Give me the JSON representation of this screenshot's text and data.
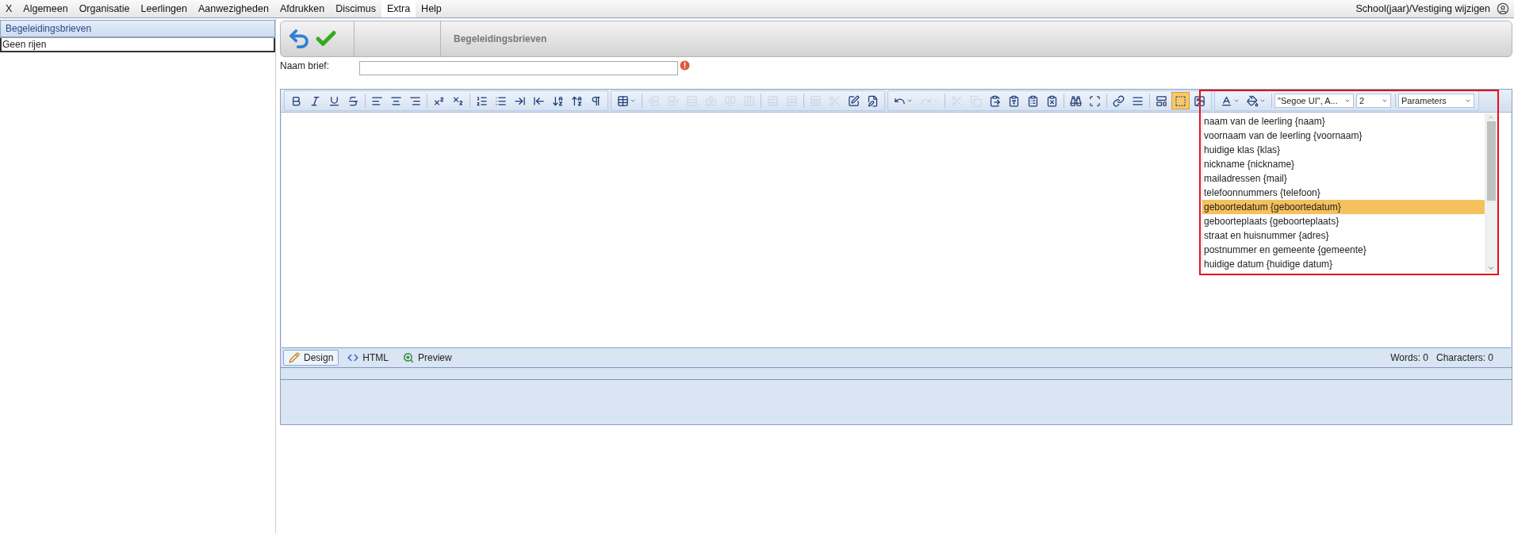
{
  "menu": [
    {
      "label": "X",
      "selected": false
    },
    {
      "label": "Algemeen",
      "selected": false
    },
    {
      "label": "Organisatie",
      "selected": false
    },
    {
      "label": "Leerlingen",
      "selected": false
    },
    {
      "label": "Aanwezigheden",
      "selected": false
    },
    {
      "label": "Afdrukken",
      "selected": false
    },
    {
      "label": "Discimus",
      "selected": false
    },
    {
      "label": "Extra",
      "selected": true
    },
    {
      "label": "Help",
      "selected": false
    }
  ],
  "account_link": "School(jaar)/Vestiging wijzigen",
  "sidebar": {
    "header": "Begeleidingsbrieven",
    "empty_message": "Geen rijen"
  },
  "page_title": "Begeleidingsbrieven",
  "name_field": {
    "label": "Naam brief:",
    "error": true
  },
  "toolbar": [
    [
      {
        "disabled": false,
        "pressed": false
      },
      {
        "disabled": false,
        "pressed": false
      },
      {
        "disabled": false,
        "pressed": false
      },
      {
        "disabled": false,
        "pressed": false
      },
      {
        "disabled": false,
        "pressed": false
      },
      {
        "disabled": false,
        "pressed": false
      },
      {
        "disabled": false,
        "pressed": false
      },
      {
        "disabled": false,
        "pressed": false
      },
      {
        "disabled": false,
        "pressed": false
      },
      {
        "disabled": false,
        "pressed": false
      },
      {
        "disabled": false,
        "pressed": false
      },
      {
        "disabled": false,
        "pressed": false
      },
      {
        "disabled": false,
        "pressed": false
      },
      {
        "disabled": false,
        "pressed": false
      },
      {
        "disabled": false,
        "pressed": false
      },
      {
        "disabled": false,
        "pressed": false
      }
    ],
    [
      {
        "disabled": false,
        "pressed": false
      },
      {
        "disabled": true,
        "pressed": false
      },
      {
        "disabled": true,
        "pressed": false
      },
      {
        "disabled": true,
        "pressed": false
      },
      {
        "disabled": true,
        "pressed": false
      },
      {
        "disabled": true,
        "pressed": false
      },
      {
        "disabled": true,
        "pressed": false
      },
      {
        "disabled": true,
        "pressed": false
      },
      {
        "disabled": true,
        "pressed": false
      },
      {
        "disabled": true,
        "pressed": false
      },
      {
        "disabled": true,
        "pressed": false
      },
      {
        "disabled": false,
        "pressed": false
      },
      {
        "disabled": false,
        "pressed": false
      }
    ],
    [
      {
        "disabled": false,
        "pressed": false
      },
      {
        "disabled": true,
        "pressed": false
      },
      {
        "disabled": true,
        "pressed": false
      },
      {
        "disabled": true,
        "pressed": false
      },
      {
        "disabled": false,
        "pressed": false
      },
      {
        "disabled": false,
        "pressed": false
      },
      {
        "disabled": false,
        "pressed": false
      },
      {
        "disabled": false,
        "pressed": false
      },
      {
        "disabled": false,
        "pressed": false
      },
      {
        "disabled": false,
        "pressed": false
      },
      {
        "disabled": false,
        "pressed": false
      },
      {
        "disabled": false,
        "pressed": false
      },
      {
        "disabled": false,
        "pressed": false
      },
      {
        "disabled": false,
        "pressed": true
      },
      {
        "disabled": false,
        "pressed": false
      }
    ]
  ],
  "format_bar": {
    "font": "\"Segoe UI\", A...",
    "size": "2",
    "parameters": "Parameters"
  },
  "parameters_list": [
    {
      "label": "naam van de leerling {naam}",
      "selected": false
    },
    {
      "label": "voornaam van de leerling {voornaam}",
      "selected": false
    },
    {
      "label": "huidige klas {klas}",
      "selected": false
    },
    {
      "label": "nickname {nickname}",
      "selected": false
    },
    {
      "label": "mailadressen {mail}",
      "selected": false
    },
    {
      "label": "telefoonnummers {telefoon}",
      "selected": false
    },
    {
      "label": "geboortedatum {geboortedatum}",
      "selected": true
    },
    {
      "label": "geboorteplaats {geboorteplaats}",
      "selected": false
    },
    {
      "label": "straat en huisnummer {adres}",
      "selected": false
    },
    {
      "label": "postnummer en gemeente {gemeente}",
      "selected": false
    },
    {
      "label": "huidige datum {huidige datum}",
      "selected": false
    }
  ],
  "mode_tabs": [
    {
      "label": "Design",
      "selected": true
    },
    {
      "label": "HTML",
      "selected": false
    },
    {
      "label": "Preview",
      "selected": false
    }
  ],
  "word_count": "Words: 0",
  "char_count": "Characters: 0"
}
